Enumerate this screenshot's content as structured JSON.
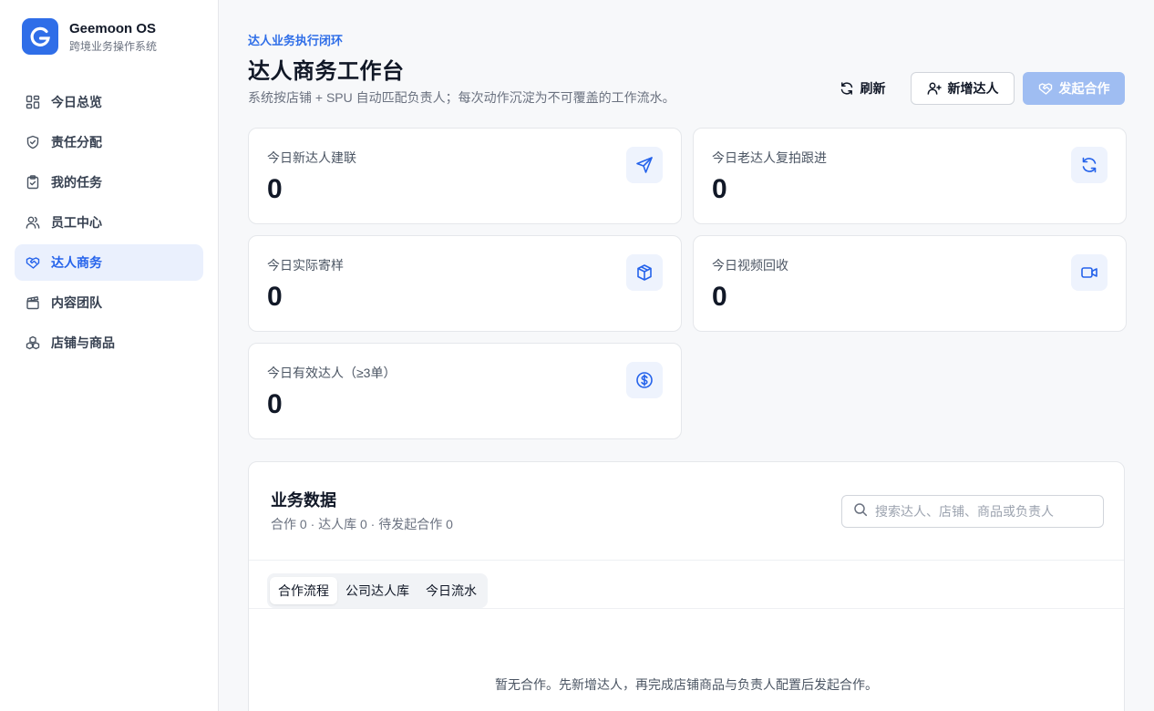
{
  "brand": {
    "name": "Geemoon OS",
    "subtitle": "跨境业务操作系统",
    "logo_letter": "G",
    "accent": "#2f6ee8"
  },
  "sidebar": {
    "items": [
      {
        "label": "今日总览",
        "icon": "dashboard-icon",
        "active": false
      },
      {
        "label": "责任分配",
        "icon": "shield-icon",
        "active": false
      },
      {
        "label": "我的任务",
        "icon": "clipboard-icon",
        "active": false
      },
      {
        "label": "员工中心",
        "icon": "users-icon",
        "active": false
      },
      {
        "label": "达人商务",
        "icon": "handshake-icon",
        "active": true
      },
      {
        "label": "内容团队",
        "icon": "clapperboard-icon",
        "active": false
      },
      {
        "label": "店铺与商品",
        "icon": "boxes-icon",
        "active": false
      }
    ]
  },
  "header": {
    "eyebrow": "达人业务执行闭环",
    "title": "达人商务工作台",
    "description": "系统按店铺 + SPU 自动匹配负责人；每次动作沉淀为不可覆盖的工作流水。"
  },
  "actions": {
    "refresh_label": "刷新",
    "add_label": "新增达人",
    "start_label": "发起合作"
  },
  "stats": [
    {
      "label": "今日新达人建联",
      "value": "0",
      "icon": "send-icon"
    },
    {
      "label": "今日老达人复拍跟进",
      "value": "0",
      "icon": "refresh-icon"
    },
    {
      "label": "今日实际寄样",
      "value": "0",
      "icon": "package-icon"
    },
    {
      "label": "今日视频回收",
      "value": "0",
      "icon": "video-icon"
    },
    {
      "label": "今日有效达人（≥3单）",
      "value": "0",
      "icon": "dollar-icon"
    }
  ],
  "panel": {
    "title": "业务数据",
    "stats_text": "合作 0 · 达人库 0 · 待发起合作 0",
    "search_placeholder": "搜索达人、店铺、商品或负责人",
    "search_value": "",
    "tabs": [
      {
        "label": "合作流程",
        "active": true
      },
      {
        "label": "公司达人库",
        "active": false
      },
      {
        "label": "今日流水",
        "active": false
      }
    ],
    "empty_text": "暂无合作。先新增达人，再完成店铺商品与负责人配置后发起合作。"
  }
}
